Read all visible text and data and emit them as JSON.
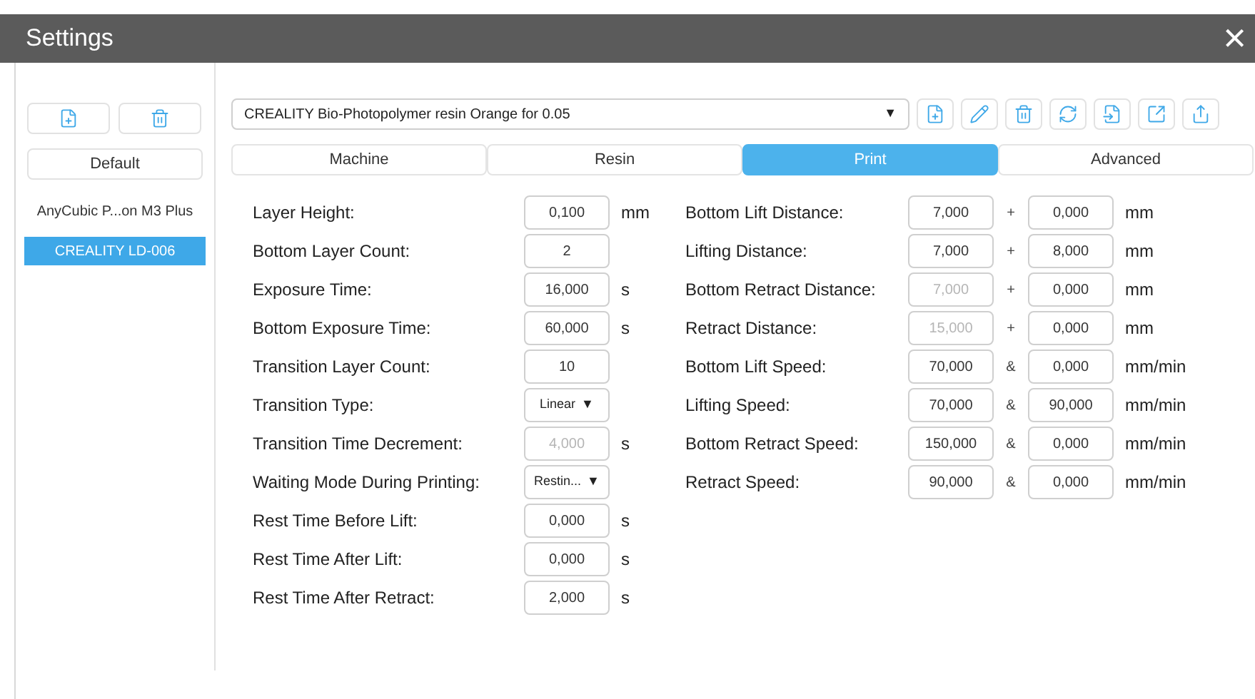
{
  "window": {
    "title": "Settings",
    "close": "×"
  },
  "profiles": {
    "default_label": "Default",
    "items": [
      {
        "label": "AnyCubic P...on M3 Plus",
        "selected": false
      },
      {
        "label": "CREALITY LD-006",
        "selected": true
      }
    ]
  },
  "resin_select": {
    "value": "CREALITY Bio-Photopolymer resin Orange for 0.05",
    "arrow": "▼"
  },
  "tabs": [
    {
      "label": "Machine",
      "selected": false
    },
    {
      "label": "Resin",
      "selected": false
    },
    {
      "label": "Print",
      "selected": true
    },
    {
      "label": "Advanced",
      "selected": false
    }
  ],
  "left_fields": [
    {
      "label": "Layer Height:",
      "kind": "input",
      "value": "0,100",
      "disabled": false,
      "unit": "mm"
    },
    {
      "label": "Bottom Layer Count:",
      "kind": "input",
      "value": "2",
      "disabled": false
    },
    {
      "label": "Exposure Time:",
      "kind": "input",
      "value": "16,000",
      "disabled": false,
      "unit": "s"
    },
    {
      "label": "Bottom Exposure Time:",
      "kind": "input",
      "value": "60,000",
      "disabled": false,
      "unit": "s"
    },
    {
      "label": "Transition Layer Count:",
      "kind": "input",
      "value": "10",
      "disabled": false
    },
    {
      "label": "Transition Type:",
      "kind": "select",
      "value": "Linear",
      "arrow": "▼"
    },
    {
      "label": "Transition Time Decrement:",
      "kind": "input",
      "value": "4,000",
      "disabled": true,
      "unit": "s"
    },
    {
      "label": "Waiting Mode During Printing:",
      "kind": "select",
      "value": "Restin...",
      "arrow": "▼"
    },
    {
      "label": "Rest Time Before Lift:",
      "kind": "input",
      "value": "0,000",
      "disabled": false,
      "unit": "s"
    },
    {
      "label": "Rest Time After Lift:",
      "kind": "input",
      "value": "0,000",
      "disabled": false,
      "unit": "s"
    },
    {
      "label": "Rest Time After Retract:",
      "kind": "input",
      "value": "2,000",
      "disabled": false,
      "unit": "s"
    }
  ],
  "right_fields": [
    {
      "label": "Bottom Lift Distance:",
      "value": "7,000",
      "disabled": false,
      "operator": "+",
      "value_2": "0,000",
      "unit": "mm"
    },
    {
      "label": "Lifting Distance:",
      "value": "7,000",
      "disabled": false,
      "operator": "+",
      "value_2": "8,000",
      "unit": "mm"
    },
    {
      "label": "Bottom Retract Distance:",
      "value": "7,000",
      "disabled": true,
      "operator": "+",
      "value_2": "0,000",
      "unit": "mm"
    },
    {
      "label": "Retract Distance:",
      "value": "15,000",
      "disabled": true,
      "operator": "+",
      "value_2": "0,000",
      "unit": "mm"
    },
    {
      "label": "Bottom Lift Speed:",
      "value": "70,000",
      "disabled": false,
      "operator": "&",
      "value_2": "0,000",
      "unit": "mm/min"
    },
    {
      "label": "Lifting Speed:",
      "value": "70,000",
      "disabled": false,
      "operator": "&",
      "value_2": "90,000",
      "unit": "mm/min"
    },
    {
      "label": "Bottom Retract Speed:",
      "value": "150,000",
      "disabled": false,
      "operator": "&",
      "value_2": "0,000",
      "unit": "mm/min"
    },
    {
      "label": "Retract Speed:",
      "value": "90,000",
      "disabled": false,
      "operator": "&",
      "value_2": "0,000",
      "unit": "mm/min"
    }
  ]
}
